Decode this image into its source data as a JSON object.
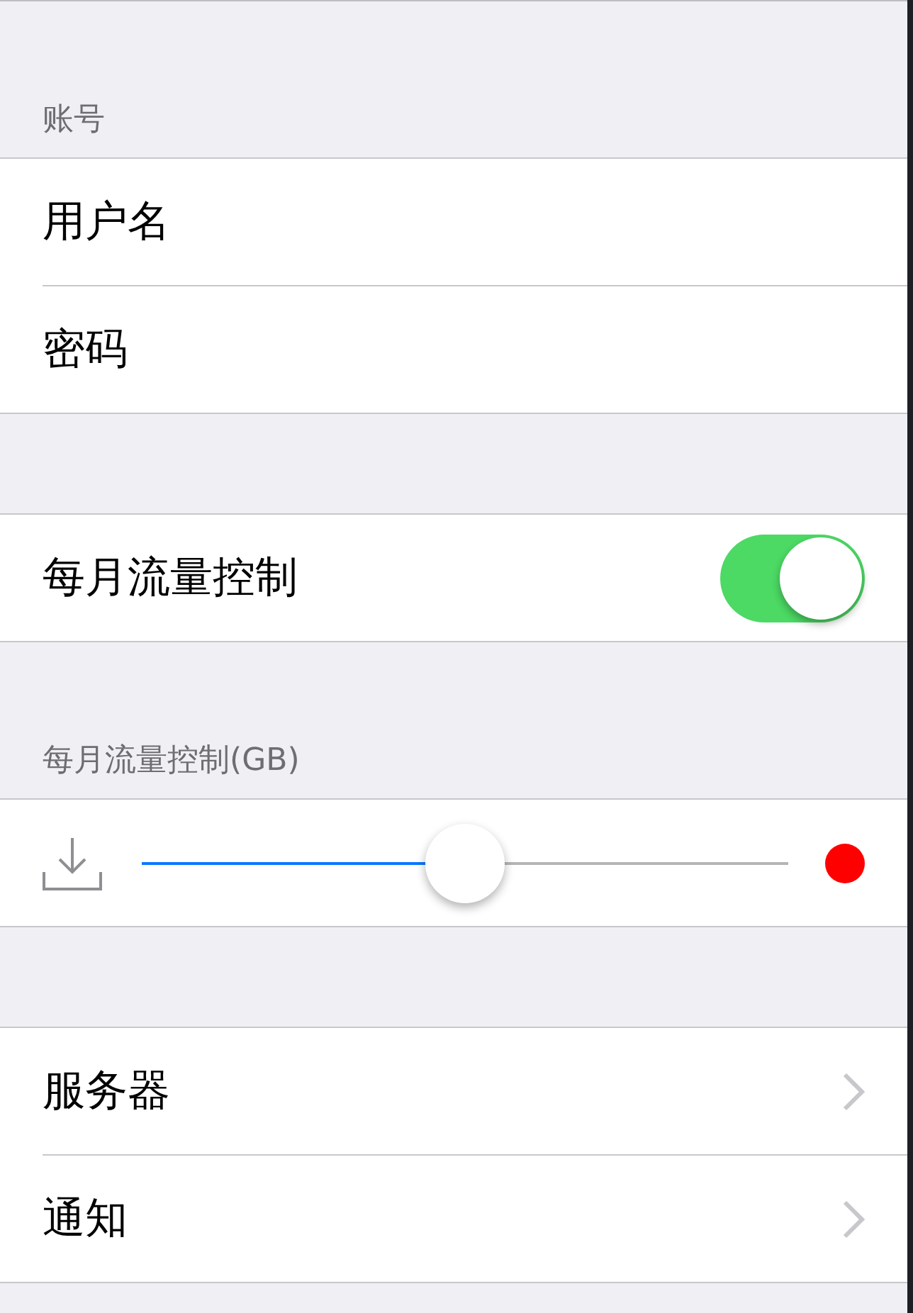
{
  "sections": [
    {
      "header": "账号",
      "rows": [
        {
          "kind": "text",
          "label": "用户名"
        },
        {
          "kind": "text",
          "label": "密码"
        }
      ]
    },
    {
      "rows": [
        {
          "kind": "switch",
          "label": "每月流量控制",
          "on": true
        }
      ]
    },
    {
      "header": "每月流量控制(GB)",
      "rows": [
        {
          "kind": "slider",
          "level": 0.5
        }
      ]
    },
    {
      "rows": [
        {
          "kind": "link",
          "label": "服务器"
        },
        {
          "kind": "link",
          "label": "通知"
        }
      ]
    }
  ]
}
